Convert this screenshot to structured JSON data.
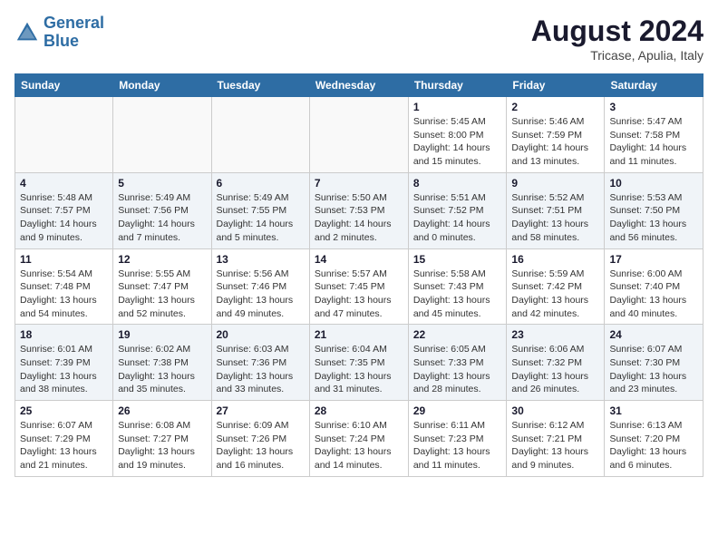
{
  "header": {
    "logo_line1": "General",
    "logo_line2": "Blue",
    "month": "August 2024",
    "location": "Tricase, Apulia, Italy"
  },
  "days_of_week": [
    "Sunday",
    "Monday",
    "Tuesday",
    "Wednesday",
    "Thursday",
    "Friday",
    "Saturday"
  ],
  "weeks": [
    [
      {
        "num": "",
        "sunrise": "",
        "sunset": "",
        "daylight": ""
      },
      {
        "num": "",
        "sunrise": "",
        "sunset": "",
        "daylight": ""
      },
      {
        "num": "",
        "sunrise": "",
        "sunset": "",
        "daylight": ""
      },
      {
        "num": "",
        "sunrise": "",
        "sunset": "",
        "daylight": ""
      },
      {
        "num": "1",
        "sunrise": "Sunrise: 5:45 AM",
        "sunset": "Sunset: 8:00 PM",
        "daylight": "Daylight: 14 hours and 15 minutes."
      },
      {
        "num": "2",
        "sunrise": "Sunrise: 5:46 AM",
        "sunset": "Sunset: 7:59 PM",
        "daylight": "Daylight: 14 hours and 13 minutes."
      },
      {
        "num": "3",
        "sunrise": "Sunrise: 5:47 AM",
        "sunset": "Sunset: 7:58 PM",
        "daylight": "Daylight: 14 hours and 11 minutes."
      }
    ],
    [
      {
        "num": "4",
        "sunrise": "Sunrise: 5:48 AM",
        "sunset": "Sunset: 7:57 PM",
        "daylight": "Daylight: 14 hours and 9 minutes."
      },
      {
        "num": "5",
        "sunrise": "Sunrise: 5:49 AM",
        "sunset": "Sunset: 7:56 PM",
        "daylight": "Daylight: 14 hours and 7 minutes."
      },
      {
        "num": "6",
        "sunrise": "Sunrise: 5:49 AM",
        "sunset": "Sunset: 7:55 PM",
        "daylight": "Daylight: 14 hours and 5 minutes."
      },
      {
        "num": "7",
        "sunrise": "Sunrise: 5:50 AM",
        "sunset": "Sunset: 7:53 PM",
        "daylight": "Daylight: 14 hours and 2 minutes."
      },
      {
        "num": "8",
        "sunrise": "Sunrise: 5:51 AM",
        "sunset": "Sunset: 7:52 PM",
        "daylight": "Daylight: 14 hours and 0 minutes."
      },
      {
        "num": "9",
        "sunrise": "Sunrise: 5:52 AM",
        "sunset": "Sunset: 7:51 PM",
        "daylight": "Daylight: 13 hours and 58 minutes."
      },
      {
        "num": "10",
        "sunrise": "Sunrise: 5:53 AM",
        "sunset": "Sunset: 7:50 PM",
        "daylight": "Daylight: 13 hours and 56 minutes."
      }
    ],
    [
      {
        "num": "11",
        "sunrise": "Sunrise: 5:54 AM",
        "sunset": "Sunset: 7:48 PM",
        "daylight": "Daylight: 13 hours and 54 minutes."
      },
      {
        "num": "12",
        "sunrise": "Sunrise: 5:55 AM",
        "sunset": "Sunset: 7:47 PM",
        "daylight": "Daylight: 13 hours and 52 minutes."
      },
      {
        "num": "13",
        "sunrise": "Sunrise: 5:56 AM",
        "sunset": "Sunset: 7:46 PM",
        "daylight": "Daylight: 13 hours and 49 minutes."
      },
      {
        "num": "14",
        "sunrise": "Sunrise: 5:57 AM",
        "sunset": "Sunset: 7:45 PM",
        "daylight": "Daylight: 13 hours and 47 minutes."
      },
      {
        "num": "15",
        "sunrise": "Sunrise: 5:58 AM",
        "sunset": "Sunset: 7:43 PM",
        "daylight": "Daylight: 13 hours and 45 minutes."
      },
      {
        "num": "16",
        "sunrise": "Sunrise: 5:59 AM",
        "sunset": "Sunset: 7:42 PM",
        "daylight": "Daylight: 13 hours and 42 minutes."
      },
      {
        "num": "17",
        "sunrise": "Sunrise: 6:00 AM",
        "sunset": "Sunset: 7:40 PM",
        "daylight": "Daylight: 13 hours and 40 minutes."
      }
    ],
    [
      {
        "num": "18",
        "sunrise": "Sunrise: 6:01 AM",
        "sunset": "Sunset: 7:39 PM",
        "daylight": "Daylight: 13 hours and 38 minutes."
      },
      {
        "num": "19",
        "sunrise": "Sunrise: 6:02 AM",
        "sunset": "Sunset: 7:38 PM",
        "daylight": "Daylight: 13 hours and 35 minutes."
      },
      {
        "num": "20",
        "sunrise": "Sunrise: 6:03 AM",
        "sunset": "Sunset: 7:36 PM",
        "daylight": "Daylight: 13 hours and 33 minutes."
      },
      {
        "num": "21",
        "sunrise": "Sunrise: 6:04 AM",
        "sunset": "Sunset: 7:35 PM",
        "daylight": "Daylight: 13 hours and 31 minutes."
      },
      {
        "num": "22",
        "sunrise": "Sunrise: 6:05 AM",
        "sunset": "Sunset: 7:33 PM",
        "daylight": "Daylight: 13 hours and 28 minutes."
      },
      {
        "num": "23",
        "sunrise": "Sunrise: 6:06 AM",
        "sunset": "Sunset: 7:32 PM",
        "daylight": "Daylight: 13 hours and 26 minutes."
      },
      {
        "num": "24",
        "sunrise": "Sunrise: 6:07 AM",
        "sunset": "Sunset: 7:30 PM",
        "daylight": "Daylight: 13 hours and 23 minutes."
      }
    ],
    [
      {
        "num": "25",
        "sunrise": "Sunrise: 6:07 AM",
        "sunset": "Sunset: 7:29 PM",
        "daylight": "Daylight: 13 hours and 21 minutes."
      },
      {
        "num": "26",
        "sunrise": "Sunrise: 6:08 AM",
        "sunset": "Sunset: 7:27 PM",
        "daylight": "Daylight: 13 hours and 19 minutes."
      },
      {
        "num": "27",
        "sunrise": "Sunrise: 6:09 AM",
        "sunset": "Sunset: 7:26 PM",
        "daylight": "Daylight: 13 hours and 16 minutes."
      },
      {
        "num": "28",
        "sunrise": "Sunrise: 6:10 AM",
        "sunset": "Sunset: 7:24 PM",
        "daylight": "Daylight: 13 hours and 14 minutes."
      },
      {
        "num": "29",
        "sunrise": "Sunrise: 6:11 AM",
        "sunset": "Sunset: 7:23 PM",
        "daylight": "Daylight: 13 hours and 11 minutes."
      },
      {
        "num": "30",
        "sunrise": "Sunrise: 6:12 AM",
        "sunset": "Sunset: 7:21 PM",
        "daylight": "Daylight: 13 hours and 9 minutes."
      },
      {
        "num": "31",
        "sunrise": "Sunrise: 6:13 AM",
        "sunset": "Sunset: 7:20 PM",
        "daylight": "Daylight: 13 hours and 6 minutes."
      }
    ]
  ]
}
